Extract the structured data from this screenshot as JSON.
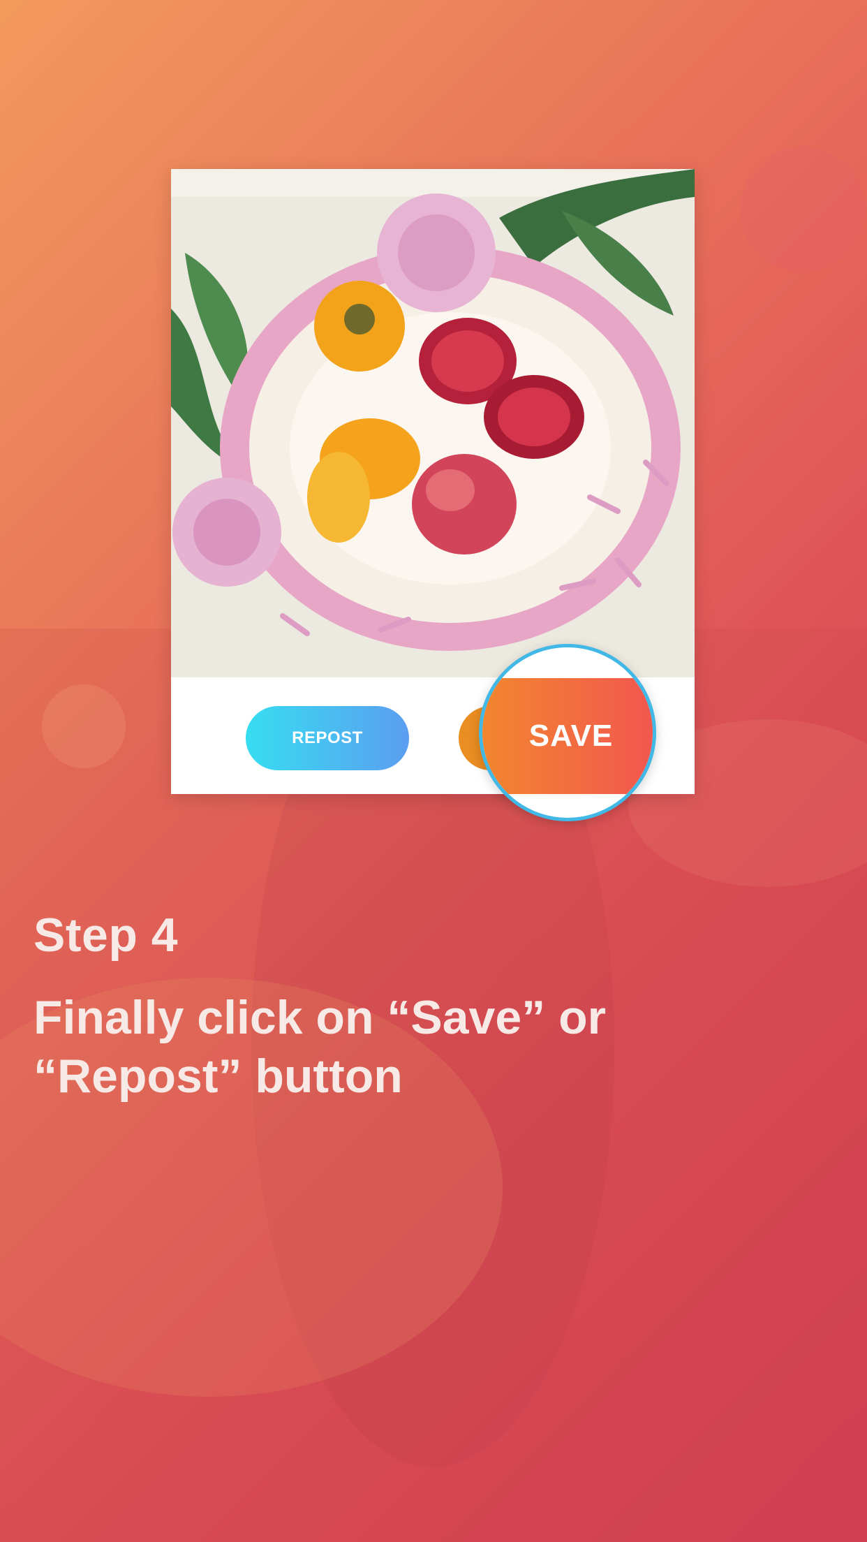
{
  "screen": {
    "background_colors": [
      "#f29a5c",
      "#e8705a",
      "#dd4d56",
      "#d23d55"
    ]
  },
  "card": {
    "photo_icon": "fruit-plate-photo",
    "repost_label": "REPOST",
    "save_label": "SAVE",
    "repost_color": "#37ddf1",
    "save_color": "#f2574f",
    "highlight_ring_color": "#41b8e6"
  },
  "instructions": {
    "step_title": "Step 4",
    "step_text": "Finally click on “Save” or “Repost” button"
  }
}
